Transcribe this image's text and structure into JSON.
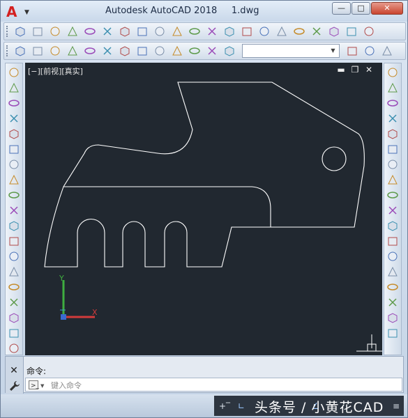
{
  "window": {
    "title": "Autodesk AutoCAD 2018     1.dwg",
    "logo_letter": "A",
    "min_glyph": "—",
    "max_glyph": "□",
    "close_glyph": "✕"
  },
  "toolbar_top": {
    "icons": [
      "box-icon",
      "cylinder-icon",
      "wedge-icon",
      "cone-icon",
      "sphere-icon",
      "cylinder-solid-icon",
      "torus-icon",
      "pyramid-icon",
      "planar-surface-icon",
      "extrude-icon",
      "presspull-icon",
      "sweep-icon",
      "revolve-icon",
      "loft-icon",
      "union-icon",
      "subtract-icon",
      "intersect-icon",
      "interfere-icon",
      "slice-icon",
      "thicken-icon",
      "extract-edges-icon"
    ],
    "layer_combo_value": ""
  },
  "toolbar_second": {
    "icons": [
      "region-icon",
      "top-view-icon",
      "bottom-view-icon",
      "left-view-icon",
      "right-view-icon",
      "front-view-icon",
      "back-view-icon",
      "sw-iso-icon",
      "se-iso-icon",
      "ne-iso-icon",
      "nw-iso-icon",
      "camera-icon",
      "orbit-icon",
      "ucs-icon",
      "ucs-world-icon",
      "ucs-previous-icon"
    ]
  },
  "viewport": {
    "label": "[−][前视][真实]",
    "min_glyph": "▬",
    "restore_glyph": "❐",
    "close_glyph": "✕",
    "background": "#212830",
    "line_color": "#ffffff",
    "ucs": {
      "x_color": "#d23b3b",
      "y_color": "#3fae3f",
      "y_label": "Y",
      "x_label": "X"
    }
  },
  "left_toolbar": {
    "icons": [
      "line-icon",
      "construction-line-icon",
      "polyline-icon",
      "polygon-icon",
      "rectangle-icon",
      "arc-icon",
      "circle-icon",
      "revision-cloud-icon",
      "spline-icon",
      "ellipse-icon",
      "ellipse-arc-icon",
      "insert-block-icon",
      "make-block-icon",
      "point-icon",
      "hatch-icon",
      "gradient-icon",
      "region-icon",
      "table-icon",
      "multiline-text-icon"
    ]
  },
  "right_toolbar": {
    "icons": [
      "erase-icon",
      "copy-icon",
      "mirror-icon",
      "offset-icon",
      "array-icon",
      "move-icon",
      "rotate-icon",
      "scale-icon",
      "stretch-icon",
      "trim-icon",
      "extend-icon",
      "break-at-point-icon",
      "break-icon",
      "join-icon",
      "chamfer-icon",
      "fillet-icon",
      "blend-curves-icon",
      "explode-icon"
    ]
  },
  "command": {
    "history": "命令:",
    "placeholder": "键入命令",
    "close_glyph": "✕"
  },
  "statusbar": {
    "watermark": "头条号 / 小黄花CAD"
  }
}
